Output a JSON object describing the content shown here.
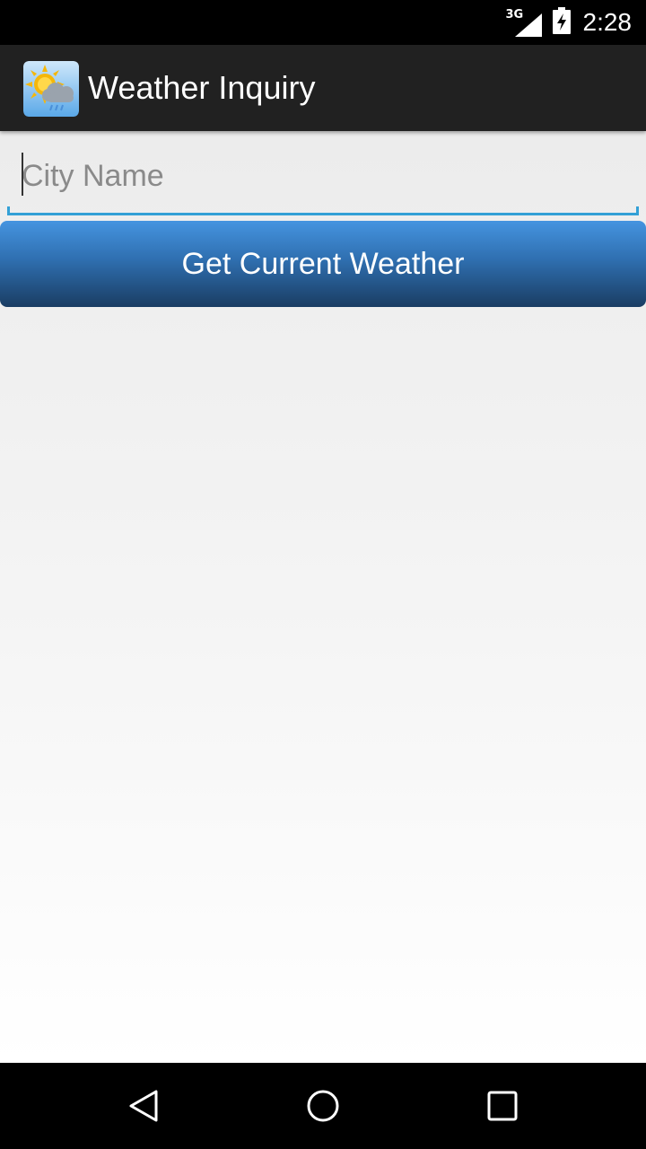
{
  "status_bar": {
    "network_type": "3G",
    "time": "2:28",
    "icons": [
      "signal-icon",
      "battery-charging-icon"
    ]
  },
  "action_bar": {
    "title": "Weather Inquiry",
    "icon": "weather-app-icon"
  },
  "form": {
    "city_input": {
      "value": "",
      "placeholder": "City Name"
    },
    "submit_label": "Get Current Weather"
  },
  "nav_bar": {
    "icons": [
      "back-icon",
      "home-icon",
      "recents-icon"
    ]
  },
  "colors": {
    "action_bar": "#212121",
    "input_underline": "#33a0d6",
    "button_top": "#4594e0",
    "button_bottom": "#1a3d63"
  }
}
